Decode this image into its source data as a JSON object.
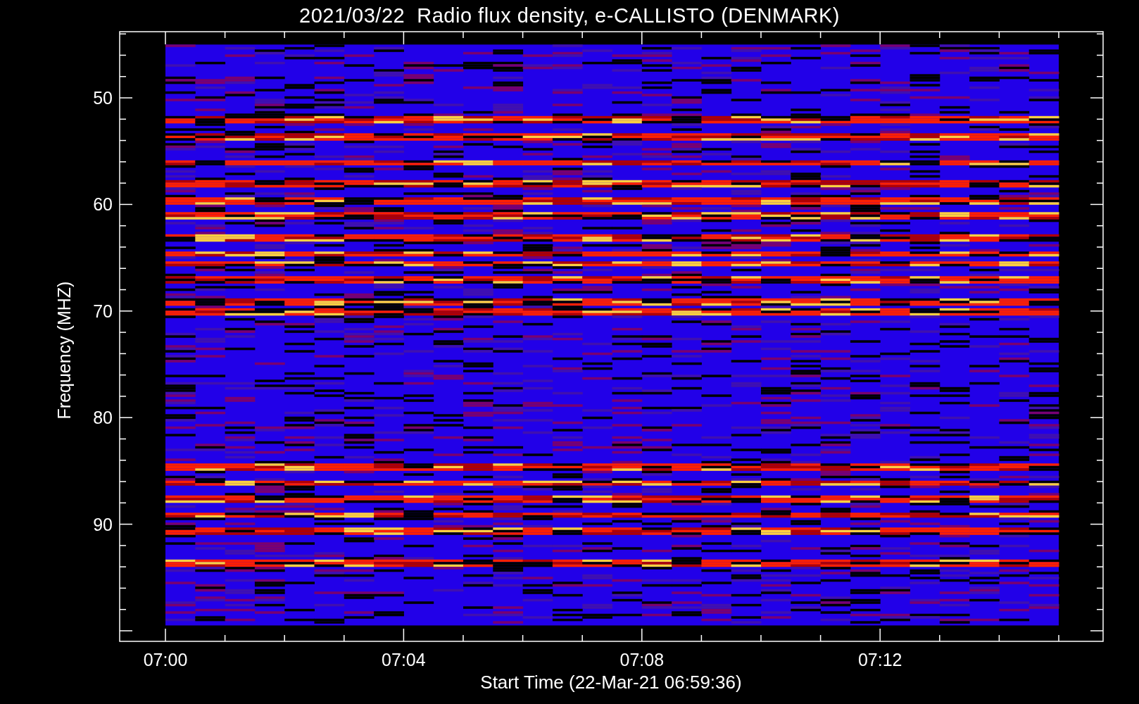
{
  "plot": {
    "title": "2021/03/22  Radio flux density, e-CALLISTO (DENMARK)",
    "ylabel": "Frequency (MHZ)",
    "xlabel": "Start Time (22-Mar-21 06:59:36)",
    "yticks": [
      {
        "label": "50"
      },
      {
        "label": "60"
      },
      {
        "label": "70"
      },
      {
        "label": "80"
      },
      {
        "label": "90"
      }
    ],
    "xticks": [
      {
        "label": "07:00"
      },
      {
        "label": "07:04"
      },
      {
        "label": "07:08"
      },
      {
        "label": "07:12"
      }
    ]
  }
}
